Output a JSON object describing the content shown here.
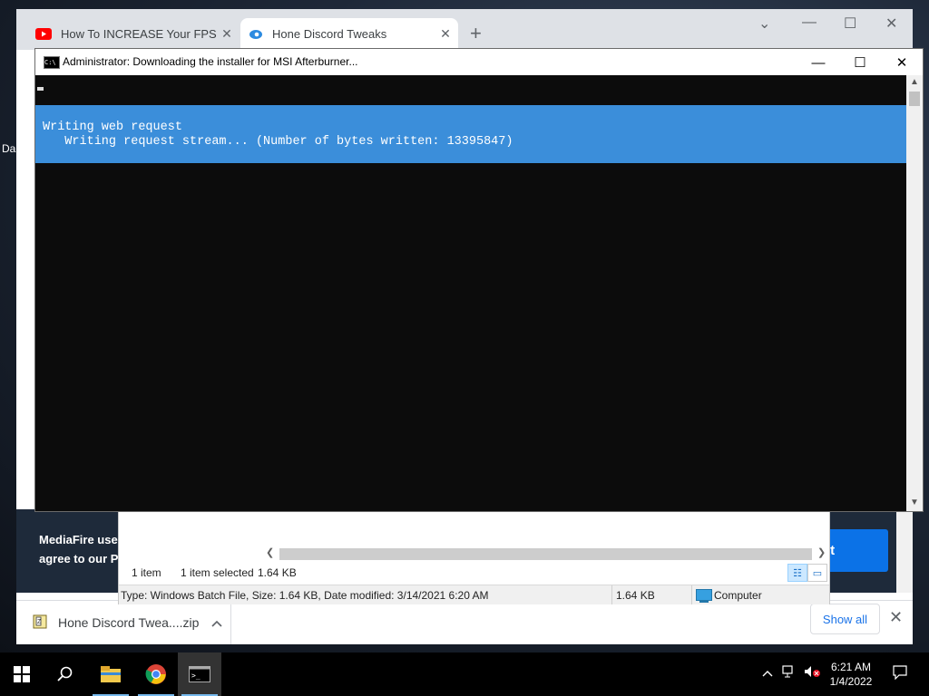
{
  "browser": {
    "tabs": [
      {
        "label": "How To INCREASE Your FPS In M",
        "icon": "youtube-icon"
      },
      {
        "label": "Hone Discord Tweaks",
        "icon": "hone-icon"
      }
    ],
    "new_tab": "+",
    "controls": {
      "chevron": "⌄",
      "minimize": "—",
      "maximize": "☐",
      "close": "✕"
    }
  },
  "desktop": {
    "frag_da": "Da"
  },
  "page": {
    "banner_line1": "MediaFire uses",
    "banner_line2": "agree to our Pr",
    "accept_label": "pt"
  },
  "downloads": {
    "filename": "Hone Discord Twea....zip",
    "show_all": "Show all",
    "close": "✕"
  },
  "explorer": {
    "item_count": "1 item",
    "selected": "1 item selected",
    "selected_size": "1.64 KB",
    "details": "Type: Windows Batch File, Size: 1.64 KB, Date modified: 3/14/2021 6:20 AM",
    "details_size": "1.64 KB",
    "location": "Computer"
  },
  "console": {
    "title": "Administrator:  Downloading the installer for MSI Afterburner...",
    "icon_text": "C:\\",
    "progress_line1": "Writing web request",
    "progress_line2": "   Writing request stream... (Number of bytes written: 13395847)",
    "minimize": "—",
    "maximize": "☐",
    "close": "✕"
  },
  "taskbar": {
    "time": "6:21 AM",
    "date": "1/4/2022",
    "items": [
      "start-icon",
      "search-icon",
      "file-explorer-icon",
      "chrome-icon",
      "cmd-icon"
    ]
  },
  "colors": {
    "console_progress_bg": "#3b8eda",
    "mediafire_accept": "#0b72e7",
    "taskbar_bg": "#000000"
  }
}
